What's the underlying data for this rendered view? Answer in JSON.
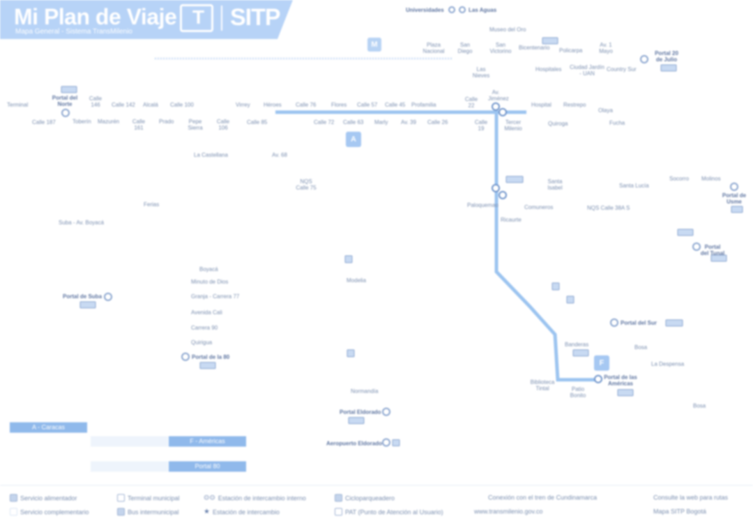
{
  "header": {
    "title": "Mi Plan de Viaje",
    "subtitle": "Mapa General - Sistema TransMilenio",
    "logo_mark": "T",
    "logo_text": "SITP",
    "colors": {
      "band": "#b7d3f7",
      "line": "#9cc4f0",
      "marker": "#8db5e8",
      "text": "#7b8fb0"
    }
  },
  "line_tags": {
    "m": "M",
    "a": "A",
    "f": "F"
  },
  "labels": {
    "top": {
      "universidades": "Universidades",
      "las_aguas": "Las Aguas",
      "museo_oro": "Museo del Oro",
      "plaza": "Plaza Nacional",
      "san_diego": "San Diego",
      "san_victorino": "San Victorino",
      "bicentenario": "Bicentenario",
      "policarpa": "Policarpa",
      "av1": "Av. 1 Mayo",
      "portal20": "Portal 20 de Julio",
      "las_nieves": "Las Nieves",
      "hospitales": "Hospitales",
      "ciudad_jardin": "Ciudad Jardín - UAN",
      "country_sur": "Country Sur"
    },
    "main_row": {
      "terminal": "Terminal",
      "portal_norte": "Portal del Norte",
      "toberin": "Toberín",
      "mazuren": "Mazurén",
      "calle_146": "Calle 146",
      "calle_142": "Calle 142",
      "alcala": "Alcalá",
      "prado": "Prado",
      "calle_100": "Calle 100",
      "virrey": "Virrey",
      "heroes": "Héroes",
      "calle_76": "Calle 76",
      "flores": "Flores",
      "calle_57": "Calle 57",
      "calle_45": "Calle 45",
      "profamilia": "Profamilia",
      "calle_22": "Calle 22",
      "av_jimenez": "Av. Jiménez",
      "hospital": "Hospital",
      "restrepo": "Restrepo",
      "olaya": "Olaya",
      "quiroga": "Quiroga",
      "calle187": "Calle 187",
      "calle161": "Calle 161",
      "calle127": "Calle 127",
      "pepe": "Pepe Sierra",
      "calle106": "Calle 106",
      "calle85": "Calle 85",
      "calle72": "Calle 72",
      "calle63": "Calle 63",
      "marly": "Marly",
      "av39": "Av. 39",
      "calle26": "Calle 26",
      "calle19": "Calle 19",
      "tercer_milenio": "Tercer Milenio",
      "fucha": "Fucha",
      "santa_lucia": "Santa Lucía"
    },
    "west": {
      "la_castellana": "La Castellana",
      "nqs_calle75": "NQS Calle 75",
      "av68": "Av. 68",
      "ferias": "Ferias",
      "boyaca": "Boyacá",
      "minuto": "Minuto de Dios",
      "granja": "Granja - Carrera 77",
      "avcali": "Avenida Cali",
      "carrera90": "Carrera 90",
      "quirigua": "Quirigua",
      "portal80": "Portal de la 80",
      "modelia": "Modelia",
      "normandia": "Normandía",
      "portal_eldorado": "Portal Eldorado",
      "aeropuerto": "Aeropuerto Eldorado"
    },
    "south": {
      "paloquemao": "Paloquemao",
      "ricaurte": "Ricaurte",
      "comuneros": "Comuneros",
      "santa_isabel": "Santa Isabel",
      "nqs_calle38": "NQS Calle 38A S",
      "portal_sur": "Portal del Sur",
      "bosa": "Bosa",
      "portal_usme": "Portal de Usme",
      "portal_tunal": "Portal del Tunal",
      "molinos": "Molinos",
      "socorro": "Socorro",
      "portal_suba": "Portal de Suba",
      "suba_tv91": "Suba - Av. Boyacá",
      "portal_americas": "Portal de las Américas",
      "patio_bonito": "Patio Bonito",
      "banderas": "Banderas",
      "biblioteca_tintal": "Biblioteca Tintal",
      "la_despensa": "La Despensa",
      "bosa_alt": "Bosa"
    }
  },
  "bars": {
    "left_label": "A - Caracas",
    "mid_label": "F - Américas",
    "low_label": "Portal 80"
  },
  "legend": {
    "a": "Servicio alimentador",
    "b": "Servicio complementario",
    "c": "Terminal municipal",
    "d": "Bus intermunicipal",
    "e": "Estación de intercambio interno",
    "f": "Estación de intercambio",
    "g": "Cicloparqueadero",
    "h": "PAT (Punto de Atención al Usuario)",
    "i": "Conexión con el tren de Cundinamarca",
    "j": "www.transmilenio.gov.co",
    "k": "Consulte la web para rutas",
    "l": "Mapa SITP Bogotá"
  }
}
